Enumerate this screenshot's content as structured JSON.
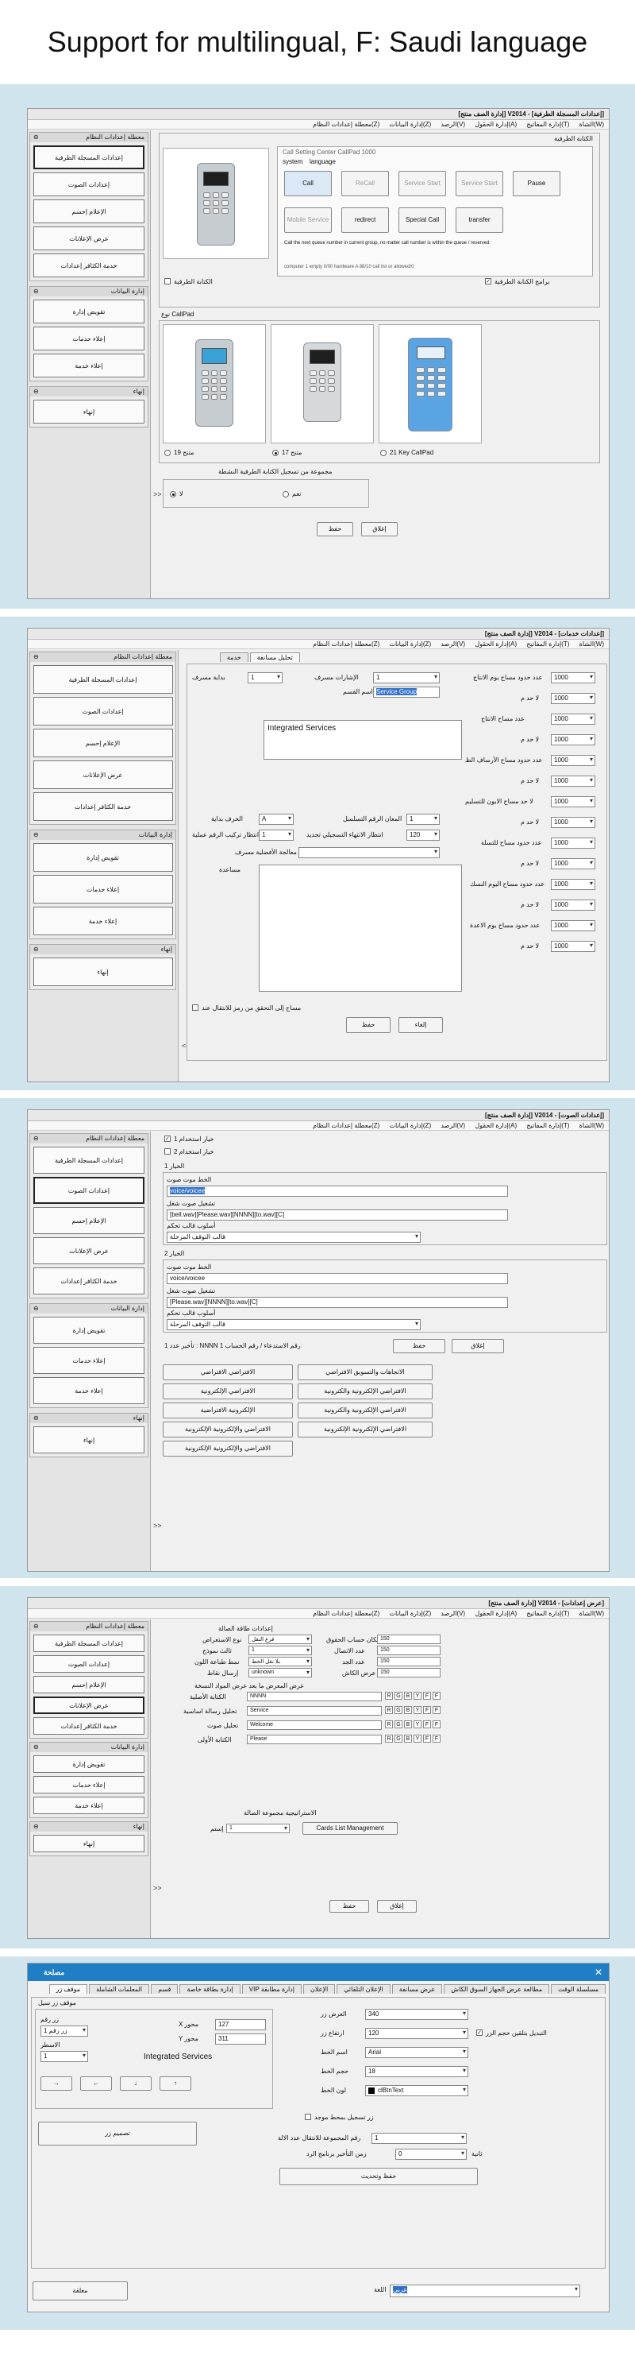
{
  "header": {
    "title": "Support for multilingual, F: Saudi language"
  },
  "common": {
    "window_title_1": "[إعدادات المسجلة الطرفية] - V2014 [إدارة الصف منتج]",
    "window_title_2": "[إعدادات خدمات] - V2014 [إدارة الصف منتج]",
    "window_title_3": "[إعدادات الصوت] - V2014 [إدارة الصف منتج]",
    "window_title_4": "[عرض إعدادات] - V2014 [إدارة الصف منتج]",
    "menu": [
      "(W)الشاة",
      "(T)إدارة المفاتيح",
      "(A)إدارة الحقول",
      "(V)الرصد",
      "(Z)إدارة البيانات",
      "(Z)معطلة إعدادات النظام"
    ],
    "sidebar": {
      "group1": "معطلة إعدادات النظام",
      "items1": [
        "إعدادات المسجلة الطرفية",
        "إعدادات الصوت",
        "الإعلام إحسم",
        "عرض الإعلانات",
        "خدمة الكثافر إعدادات"
      ],
      "group2": "إدارة البيانات",
      "items2": [
        "تقويض إدارة",
        "إعلاء حدمات",
        "إعلاء خدمة"
      ],
      "group3": "إنهاء",
      "items3": [
        "إنهاء"
      ]
    }
  },
  "s1": {
    "term_label": "الكتابة الطرفية",
    "device_caption": "نوع CallPad",
    "inner_title": "Call Setting Center CallPad 1000",
    "inner_menu": [
      "system",
      "language"
    ],
    "inner_buttons": [
      "Call",
      "ReCall",
      "Service Start",
      "Service Start",
      "Pause",
      "Mobile Service",
      "redirect",
      "Special Call",
      "transfer"
    ],
    "inner_status": "Call the next queue number in current group, no matter call number is within the queue / reserved",
    "inner_footer": "computer 1    empty 0/00       hardware A 88/10    call list or allowed/0",
    "check_label_left": "الكتابة الطرفية",
    "check_label_right": "برامج الكتابة الطرفية",
    "devices": [
      {
        "caption": "متنح 19"
      },
      {
        "caption": "متنح 17"
      },
      {
        "caption": "21 Key CallPad"
      }
    ],
    "radio_group": "مجموعة من تسجيل الكتابة الطرفية النشطة",
    "radio_no": "لا",
    "radio_yes": "نعم",
    "save": "حفظ",
    "close": "إغلاق"
  },
  "s2": {
    "tabs": [
      "تحليل مسانفة",
      "خدمة"
    ],
    "prefix_label": "بداية مسرف",
    "prefix_value": "1",
    "led_label": "الإشارات مسرف",
    "led_value": "1",
    "service_name_label": "اسم القسم",
    "service_name": "Service Group",
    "desc": "Integrated Services",
    "limits": [
      {
        "label": "عدد حدود مساح يوم الانتاج",
        "value": "1000"
      },
      {
        "label": "لا حد م",
        "value": "1000"
      },
      {
        "label": "عدد مساح الانتاج",
        "value": "1000"
      },
      {
        "label": "لا حد م",
        "value": "1000"
      },
      {
        "label": "عدد حدود مساح الأرساف الظ",
        "value": "1000"
      },
      {
        "label": "لا حد م",
        "value": "1000"
      },
      {
        "label": "لا حد مساح الايون للتسليم",
        "value": "1000"
      },
      {
        "label": "لا حد م",
        "value": "1000"
      },
      {
        "label": "عدد حدود مساح للتسلة",
        "value": "1000"
      },
      {
        "label": "لا حد م",
        "value": "1000"
      },
      {
        "label": "عدد حدود مساح اليوم النسك",
        "value": "1000"
      },
      {
        "label": "لا حد م",
        "value": "1000"
      },
      {
        "label": "عدد حدود مساح يوم الاعدة",
        "value": "1000"
      },
      {
        "label": "لا حد م",
        "value": "1000"
      }
    ],
    "letter_label": "الحرف بداية",
    "letter_value": "A",
    "digits_label": "المعان الرقم التسلسل",
    "digits_value": "1",
    "wait_label": "انتظار تركيب الرقم عملية",
    "wait_value": "1",
    "timeout_label": "انتظار الانتهاء التسجيلي تحديد",
    "timeout_value": "120",
    "priority_label": "معالجة الأفضلية مسرف",
    "help_label": "مساعدة",
    "check_label": "مساح إلى التحقق من رمز للانتقال عند",
    "save": "حفظ",
    "close": "إلغاء"
  },
  "s3": {
    "chk1": "خيار استخدام 1",
    "chk2": "خيار استخدام 2",
    "sec1": "الخيار 1",
    "sec1_fields": [
      {
        "label": "الخط موت صوت",
        "value": "voice/voicee"
      },
      {
        "label": "تشغيل صوت شغل",
        "value": "[bell.wav][Please.wav][NNNN][to.wav][C]"
      },
      {
        "label": "أسلوب قالب تحكم",
        "value": "قالب التوقف المرحلة"
      }
    ],
    "sec2": "الخيار 2",
    "sec2_fields": [
      {
        "label": "الخط موت صوت",
        "value": "voice/voicee"
      },
      {
        "label": "تشغيل صوت شغل",
        "value": "[Please.wav][NNNN][to.wav][C]"
      },
      {
        "label": "أسلوب قالب تحكم",
        "value": "قالب التوقف المرحلة"
      }
    ],
    "note": "تأخير عدد 1 : NNNN رقم الاستدعاء / رقم الحساب 1",
    "save": "حفظ",
    "close": "إغلاق",
    "lang_buttons": [
      "الاتجاهات والتسويق الافتراضي",
      "الافتراضي الافتراضي",
      "الافتراضي الإلكترونية والكترونية",
      "الافتراضي الإلكترونية",
      "الافتراضي الإلكترونية والكترونية",
      "الإلكترونية الافتراضية",
      "الافتراضي الإلكترونية الإلكترونية",
      "الافتراضي والإلكترونية الإلكترونية",
      "الافتراضي والإلكترونية الإلكترونية"
    ]
  },
  "s4": {
    "section": "إعدادات طاقة الصالة",
    "left_rows": [
      {
        "label": "نوع الاستعراض",
        "value": "فرع النقل"
      },
      {
        "label": "ثالث نموذج",
        "value": "1"
      },
      {
        "label": "نمط طباعة اللون",
        "value": "بلا نقل الخط"
      },
      {
        "label": "إرسال نقاط",
        "value": "unknown"
      }
    ],
    "right_rows": [
      {
        "label": "مكان حساب الحقوق",
        "value": "150"
      },
      {
        "label": "عدد الاتصال",
        "value": "150"
      },
      {
        "label": "عدد الجد",
        "value": "150"
      },
      {
        "label": "عرض الكاش",
        "value": "150"
      }
    ],
    "lines_title": "عرض المعرض ما بعد عرض المواد النسخة",
    "lines": [
      {
        "label": "الكتابة الأصلية",
        "value": "NNNN"
      },
      {
        "label": "تحليل رسالة اساسية",
        "value": "Service"
      },
      {
        "label": "تحليل صوت",
        "value": "Welcome"
      },
      {
        "label": "الكتابة الأولى",
        "value": "Please"
      }
    ],
    "rgb_letters": [
      "R",
      "G",
      "B",
      "Y",
      "F",
      "F"
    ],
    "group_label": "الاستراتيجية مجموعة الصالة",
    "group_sub": "إستم",
    "group_value": "1",
    "card_button": "Cards List Management",
    "save": "حفظ",
    "close": "إغلاق"
  },
  "s5": {
    "title": "مصلحة",
    "tabs": [
      "مسلسلة الوقت",
      "مطالعة عرض الجهاز السوق الكاش",
      "عرض مسانفة",
      "الإعلان التلقائي",
      "الإعلان",
      "إدارة مطابقة VIP",
      "إدارة بطاقة خاصة",
      "قسم",
      "المعلمات الشاملة",
      "موقف زر"
    ],
    "section": "موقف زر سيل",
    "btn_number_label": "زر رقم",
    "btn_number_value": "زر رقم 1",
    "row_label": "الاسطر",
    "row_value": "1",
    "x_label": "X محور",
    "x_value": "127",
    "y_label": "Y محور",
    "y_value": "311",
    "preview_text": "Integrated Services",
    "arrows": [
      "→",
      "←",
      "↓",
      "↑"
    ],
    "design_button": "تصميم زر",
    "fields": [
      {
        "label": "العرض زر",
        "value": "340"
      },
      {
        "label": "ارتفاع زر",
        "value": "120"
      },
      {
        "label": "اسم الخط",
        "value": "Arial"
      },
      {
        "label": "حجم الخط",
        "value": "18"
      },
      {
        "label": "لون الخط",
        "value": "clBtnText"
      }
    ],
    "auto_size": "التبديل بتلقين حجم الزر",
    "underline_label": "زر تسجيل بمحط موجد",
    "multiply_label": "رقم المجموعة للانتقال عدد الالة",
    "multiply_value": "1",
    "delay_label": "زمن التأخير برنامج الرد",
    "delay_value": "0",
    "delay_unit": "ثانية",
    "save_btn": "حفظ وتحديث",
    "lang_label": "اللغة",
    "lang_value": "عربي",
    "cancel": "مغلقة"
  }
}
